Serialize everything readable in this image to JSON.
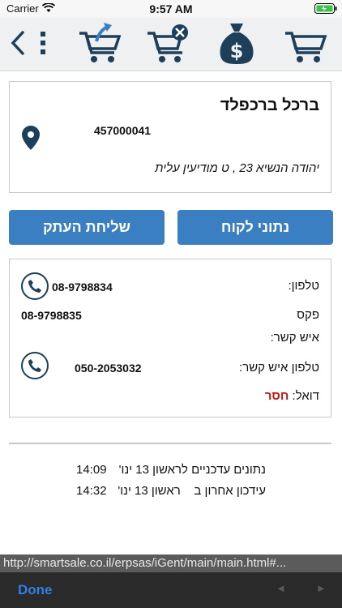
{
  "status_bar": {
    "carrier": "Carrier",
    "time": "9:57 AM"
  },
  "toolbar": {
    "icons": [
      "back-arrow-icon",
      "more-vertical-icon",
      "cart-send-icon",
      "cart-remove-icon",
      "money-bag-icon",
      "shopping-cart-icon"
    ]
  },
  "customer": {
    "name": "ברכל ברכפלד",
    "id": "457000041",
    "address": "יהודה הנשיא 23 , ט מודיעין עלית"
  },
  "actions": {
    "send_copy": "שליחת העתק",
    "customer_data": "נתוני לקוח"
  },
  "contact": {
    "phone_label": "טלפון:",
    "phone_value": "08-9798834",
    "fax_label": "פקס",
    "fax_value": "08-9798835",
    "contact_person_label": "איש קשר:",
    "contact_phone_label": "טלפון איש קשר:",
    "contact_phone_value": "050-2053032",
    "email_label": "דואל:",
    "email_value": "חסר"
  },
  "updates": {
    "data_updated_label": "נתונים עדכניים ל",
    "data_updated_date": "ראשון 13 ינו'",
    "data_updated_time": "14:09",
    "last_update_label": "עידכון אחרון ב",
    "last_update_date": "ראשון 13 ינו'",
    "last_update_time": "14:32"
  },
  "browser": {
    "url": "http://smartsale.co.il/erpsas/iGent/main/main.html#...",
    "done_label": "Done",
    "prev_glyph": "◄",
    "next_glyph": "►"
  },
  "colors": {
    "accent_blue": "#3a7fc1",
    "icon_navy": "#1e3f5a",
    "missing_red": "#c0141b"
  }
}
